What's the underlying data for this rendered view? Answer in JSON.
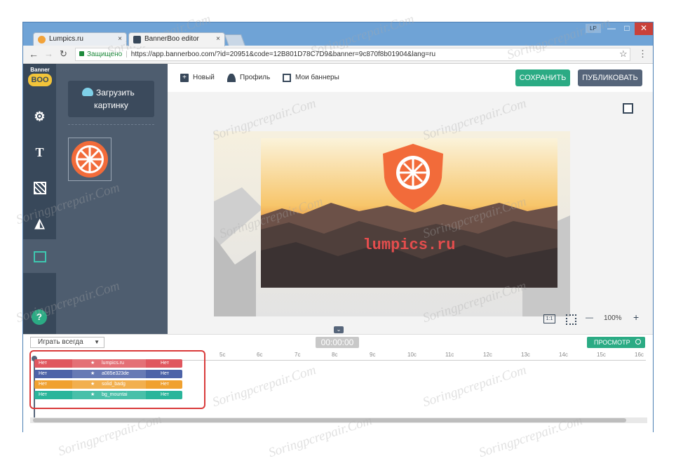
{
  "browser": {
    "tabs": [
      {
        "title": "Lumpics.ru",
        "close": "×"
      },
      {
        "title": "BannerBoo editor",
        "close": "×"
      }
    ],
    "profile_badge": "LP",
    "window_controls": {
      "minimize": "—",
      "maximize": "□",
      "close": "✕"
    },
    "address": {
      "secure_label": "Защищено",
      "url": "https://app.bannerboo.com/?id=20951&code=12B801D78C7D9&banner=9c870f8b01904&lang=ru"
    }
  },
  "app": {
    "logo": {
      "line1": "Banner",
      "line2": "BOO"
    },
    "upload_button": {
      "line1": "Загрузить",
      "line2": "картинку"
    },
    "topbar": {
      "new_label": "Новый",
      "profile_label": "Профиль",
      "my_banners_label": "Мои баннеры",
      "save_label": "СОХРАНИТЬ",
      "publish_label": "ПУБЛИКОВАТЬ"
    },
    "banner_text": "lumpics.ru",
    "zoom": {
      "ratio_label": "1:1",
      "minus": "—",
      "level": "100%",
      "plus": "+"
    },
    "timeline": {
      "play_mode": "Играть всегда",
      "time": "00:00:00",
      "preview_label": "ПРОСМОТР",
      "ruler": [
        "5c",
        "6c",
        "7c",
        "8c",
        "9c",
        "10c",
        "11c",
        "12c",
        "13c",
        "14c",
        "15c",
        "16c"
      ],
      "layers": [
        {
          "left": "Нет",
          "name": "lumpics.ru",
          "right": "Нет",
          "color": "#e0575f"
        },
        {
          "left": "Нет",
          "name": "a085e323de",
          "right": "Нет",
          "color": "#4d63a8"
        },
        {
          "left": "Нет",
          "name": "solid_badg",
          "right": "Нет",
          "color": "#f0a130"
        },
        {
          "left": "Нет",
          "name": "bg_mountai",
          "right": "Нет",
          "color": "#2ab59b"
        }
      ]
    }
  },
  "watermark": "Soringpcrepair.Com",
  "colors": {
    "save": "#2bab84",
    "publish": "#56657a",
    "nav_dark": "#38485a",
    "nav_panel": "#4e5d6f",
    "highlight": "#d93a3a",
    "orange": "#f26b3a"
  }
}
